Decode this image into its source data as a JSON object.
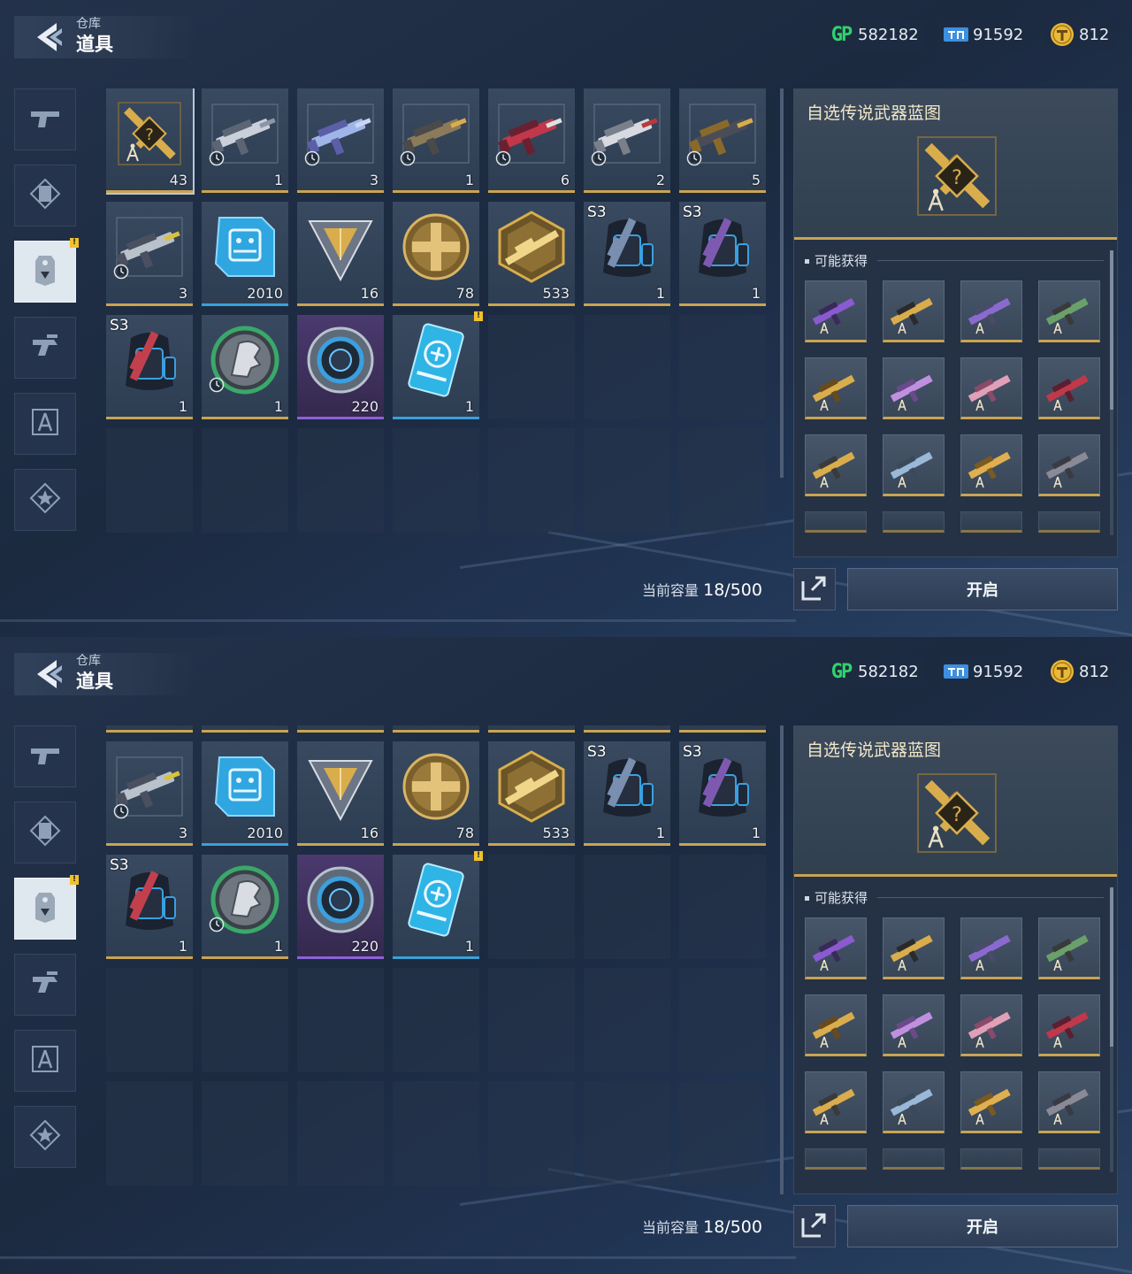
{
  "header": {
    "breadcrumb": "仓库",
    "title": "道具"
  },
  "currencies": [
    {
      "icon": "gp-icon",
      "label": "GP",
      "value": "582182"
    },
    {
      "icon": "ticket-icon",
      "value": "91592"
    },
    {
      "icon": "gold-coin-icon",
      "value": "812"
    }
  ],
  "sidebar": {
    "tabs": [
      {
        "icon": "pistol-icon"
      },
      {
        "icon": "frame-icon"
      },
      {
        "icon": "tag-icon",
        "active": true,
        "alert": "!"
      },
      {
        "icon": "drone-icon"
      },
      {
        "icon": "blueprint-icon"
      },
      {
        "icon": "star-badge-icon"
      }
    ]
  },
  "items": [
    {
      "name": "legendary-blueprint-selector",
      "count": "43",
      "selected": true,
      "rarity": "gold"
    },
    {
      "name": "pistol-silver",
      "count": "1",
      "timed": true
    },
    {
      "name": "blade-rifle",
      "count": "3",
      "timed": true
    },
    {
      "name": "pistol-bronze",
      "count": "1",
      "timed": true
    },
    {
      "name": "shotgun-red",
      "count": "6",
      "timed": true
    },
    {
      "name": "launcher-silver",
      "count": "2",
      "timed": true
    },
    {
      "name": "smg-dark",
      "count": "5",
      "timed": true
    },
    {
      "name": "rifle-camo",
      "count": "3",
      "timed": true
    },
    {
      "name": "chip-card",
      "count": "2010",
      "rarity": "blue"
    },
    {
      "name": "triangle-token",
      "count": "16"
    },
    {
      "name": "cross-medal",
      "count": "78"
    },
    {
      "name": "weapon-hex-badge",
      "count": "533"
    },
    {
      "name": "backpack-blue",
      "count": "1",
      "badge": "S3"
    },
    {
      "name": "backpack-violet",
      "count": "1",
      "badge": "S3"
    },
    {
      "name": "backpack-red",
      "count": "1",
      "badge": "S3"
    },
    {
      "name": "helmet-emblem",
      "count": "1",
      "timed": true
    },
    {
      "name": "purple-ring-core",
      "count": "220",
      "rarity": "purple"
    },
    {
      "name": "exchange-card",
      "count": "1",
      "alert": "!",
      "rarity": "blue"
    }
  ],
  "capacity": {
    "label": "当前容量",
    "used": "18",
    "total": "/500"
  },
  "detail": {
    "title": "自选传说武器蓝图",
    "possible_label": "可能获得",
    "rewards": [
      "purple-rifle",
      "gold-black-rifle",
      "purple-sniper",
      "green-smg",
      "gold-launcher",
      "pink-shotgun",
      "pink-blade",
      "red-shotgun",
      "gold-pistol",
      "blue-smg",
      "gold-rifle",
      "dark-smg"
    ]
  },
  "actions": {
    "open_label": "开启"
  }
}
